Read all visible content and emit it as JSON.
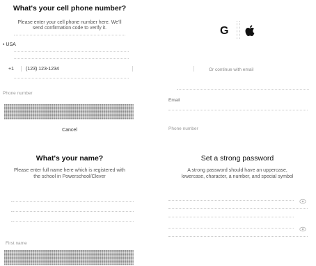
{
  "phone_panel": {
    "title": "What's your cell phone number?",
    "subtitle_line1": "Please enter your cell phone number here. We'll",
    "subtitle_line2": "send confirmation code to verify it.",
    "country": "• USA",
    "country_code": "+1",
    "phone_value": "(123) 123-1234",
    "field_label": "Phone number",
    "cancel_label": "Cancel"
  },
  "social_panel": {
    "google_glyph": "G",
    "apple_glyph": "",
    "divider_text": "Or continue with email",
    "email_label": "Email",
    "field_label": "Phone number"
  },
  "name_panel": {
    "title": "What's your name?",
    "subtitle_line1": "Please enter full name here which is registered with",
    "subtitle_line2": "the school in Powerschool/Clever",
    "field_label": "First name"
  },
  "password_panel": {
    "title": "Set a strong password",
    "subtitle_line1": "A strong password should have an uppercase,",
    "subtitle_line2": "lowercase, character, a number, and special symbol"
  }
}
